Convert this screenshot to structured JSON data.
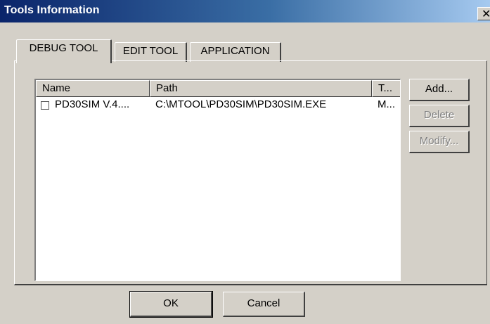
{
  "window": {
    "title": "Tools Information",
    "close_icon": "close-icon"
  },
  "tabs": [
    {
      "label": "DEBUG TOOL",
      "active": true
    },
    {
      "label": "EDIT TOOL",
      "active": false
    },
    {
      "label": "APPLICATION",
      "active": false
    }
  ],
  "list": {
    "columns": [
      "Name",
      "Path",
      "T..."
    ],
    "rows": [
      {
        "checked": false,
        "name": "PD30SIM V.4....",
        "path": "C:\\MTOOL\\PD30SIM\\PD30SIM.EXE",
        "type": "M..."
      }
    ]
  },
  "side_buttons": {
    "add": {
      "label": "Add...",
      "enabled": true
    },
    "delete": {
      "label": "Delete",
      "enabled": false
    },
    "modify": {
      "label": "Modify...",
      "enabled": false
    }
  },
  "footer": {
    "ok_label": "OK",
    "cancel_label": "Cancel"
  },
  "colors": {
    "face": "#d4d0c8",
    "title_gradient_start": "#0a246a",
    "title_gradient_end": "#a6caf0",
    "disabled_text": "#808080"
  }
}
